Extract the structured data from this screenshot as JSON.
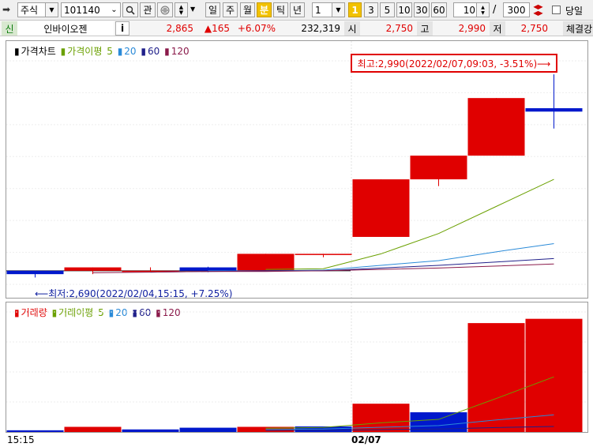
{
  "toolbar": {
    "market_select": "주식",
    "code_input": "101140",
    "search_label": "관",
    "periods": [
      "일",
      "주",
      "월",
      "분",
      "틱",
      "년"
    ],
    "selected_period": "분",
    "interval_value": "1",
    "preset_one": "1",
    "minutes": [
      "3",
      "5",
      "10",
      "30",
      "60"
    ],
    "count_value": "10",
    "slash": "/",
    "total_value": "300",
    "today_label": "당일"
  },
  "info": {
    "credit_badge": "신",
    "stock_name": "인바이오젠",
    "info_button": "i",
    "price": "2,865",
    "change": "▲165",
    "change_pct": "+6.07%",
    "volume": "232,319",
    "open_label": "시",
    "open_value": "2,750",
    "high_label": "고",
    "high_value": "2,990",
    "low_label": "저",
    "low_value": "2,750",
    "trade_label": "체결강"
  },
  "price_panel": {
    "legend": {
      "main": "가격차트",
      "ma_label": "가격이평",
      "ma_periods": [
        "5",
        "20",
        "60",
        "120"
      ]
    },
    "max_annotation": "최고:2,990(2022/02/07,09:03, -3.51%)⟶",
    "min_annotation": "⟵최저:2,690(2022/02/04,15:15, +7.25%)"
  },
  "volume_panel": {
    "legend": {
      "main": "거래량",
      "ma_label": "거래이평",
      "ma_periods": [
        "5",
        "20",
        "60",
        "120"
      ]
    }
  },
  "x_axis": {
    "left_label": "15:15",
    "date_label": "02/07"
  },
  "colors": {
    "up": "#e00000",
    "down": "#0018cc",
    "ma5": "#6aa000",
    "ma20": "#2a8ad8",
    "ma60": "#20208a",
    "ma120": "#8a1a4a"
  },
  "chart_data": {
    "type": "candlestick",
    "x": [
      "02/04 15:15",
      "02/04 15:16",
      "02/04 15:17",
      "02/04 15:18",
      "02/04 15:19",
      "02/04 15:20",
      "02/07 09:00",
      "02/07 09:01",
      "02/07 09:02",
      "02/07 09:03"
    ],
    "price_ylim": [
      2680,
      3010
    ],
    "candles": [
      {
        "o": 2700,
        "h": 2700,
        "l": 2690,
        "c": 2695
      },
      {
        "o": 2700,
        "h": 2705,
        "l": 2695,
        "c": 2705
      },
      {
        "o": 2700,
        "h": 2705,
        "l": 2698,
        "c": 2700
      },
      {
        "o": 2705,
        "h": 2706,
        "l": 2698,
        "c": 2700
      },
      {
        "o": 2700,
        "h": 2725,
        "l": 2700,
        "c": 2725
      },
      {
        "o": 2725,
        "h": 2725,
        "l": 2720,
        "c": 2725
      },
      {
        "o": 2750,
        "h": 2835,
        "l": 2750,
        "c": 2835
      },
      {
        "o": 2835,
        "h": 2870,
        "l": 2825,
        "c": 2870
      },
      {
        "o": 2870,
        "h": 2955,
        "l": 2870,
        "c": 2955
      },
      {
        "o": 2940,
        "h": 2990,
        "l": 2910,
        "c": 2935
      }
    ],
    "volumes": [
      2000,
      6000,
      3000,
      5000,
      6000,
      6500,
      33000,
      23000,
      127000,
      132000
    ],
    "volume_colors": [
      "down",
      "up",
      "down",
      "down",
      "up",
      "down",
      "up",
      "down",
      "up",
      "up"
    ],
    "volume_ylim": [
      0,
      140000
    ],
    "price_ma": {
      "ma5": [
        null,
        null,
        null,
        null,
        2702,
        2703,
        2725,
        2755,
        2795,
        2835
      ],
      "ma20": [
        null,
        null,
        null,
        2700,
        2700,
        2701,
        2708,
        2715,
        2728,
        2740
      ],
      "ma60": [
        null,
        null,
        2698,
        2699,
        2700,
        2700,
        2704,
        2708,
        2713,
        2718
      ],
      "ma120": [
        null,
        2697,
        2698,
        2699,
        2699,
        2700,
        2702,
        2704,
        2707,
        2710
      ]
    },
    "volume_ma": {
      "ma5": [
        null,
        null,
        null,
        null,
        4400,
        5300,
        10700,
        14700,
        39100,
        64300
      ],
      "ma20": [
        null,
        null,
        null,
        null,
        3000,
        3500,
        5500,
        7500,
        14000,
        20000
      ],
      "ma60": [
        null,
        null,
        null,
        null,
        1800,
        2000,
        2800,
        3500,
        5200,
        6500
      ]
    }
  }
}
